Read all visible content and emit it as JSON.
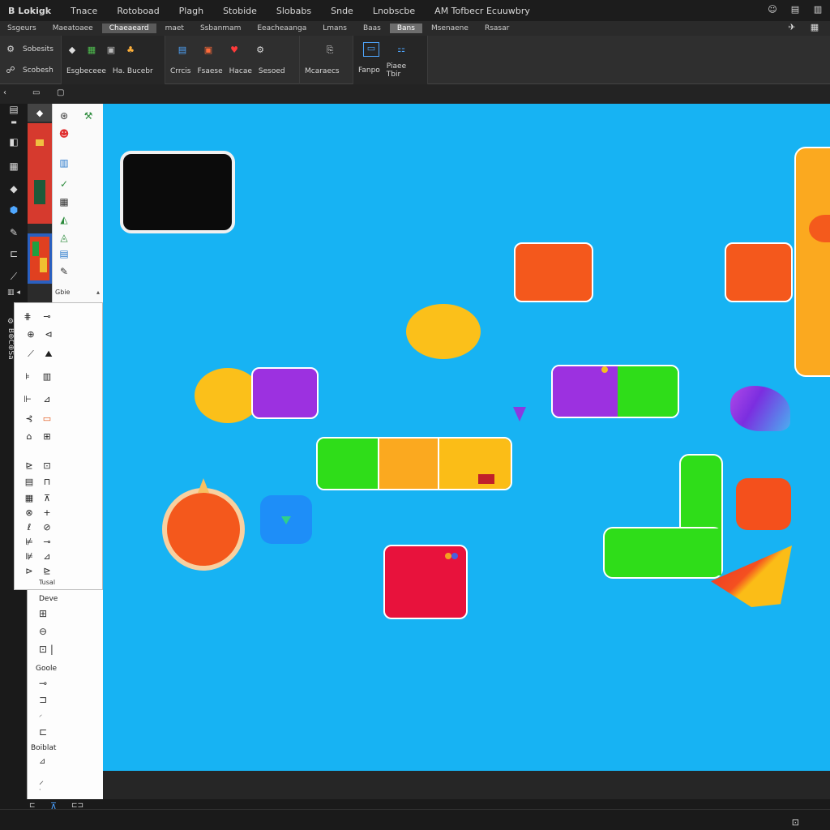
{
  "menu": {
    "items": [
      "B Lokigk",
      "Tnace",
      "Rotoboad",
      "Plagh",
      "Stobide",
      "Slobabs",
      "Snde",
      "Lnobscbe",
      "AM Tofbecr Ecuuwbry"
    ]
  },
  "tabs": {
    "items": [
      "Ssgeurs",
      "Maeatoaee",
      "Chaeaeard",
      "maet",
      "Ssbanmam",
      "Eeacheaanga",
      "Lmans",
      "Baas",
      "Bans",
      "Msenaene",
      "Rsasar"
    ],
    "active_index": 2,
    "selected_index": 8
  },
  "ribbon": {
    "left_labels": [
      "Sobesits",
      "Scobesh"
    ],
    "group2_labels": [
      "Esgbeceee",
      "Ha. Bucebr"
    ],
    "group3_labels": [
      "Crrcis",
      "Fsaese",
      "Hacae",
      "Sesoed"
    ],
    "group4_label": "Mcaraecs",
    "group5_labels": [
      "Fanpo",
      "Piaee Tbir"
    ]
  },
  "palette": {
    "section_label": "Gbie"
  },
  "lower_panel": {
    "labels": [
      "Tusal",
      "Deve",
      "Goole",
      "Boiblat"
    ]
  },
  "canvas": {
    "background": "#17b3f3"
  },
  "colors": {
    "orange": "#f4581c",
    "yellow": "#fbbd17",
    "purple": "#9c31e0",
    "green": "#2fdd19",
    "red": "#e8123c",
    "amber": "#fba91f"
  }
}
